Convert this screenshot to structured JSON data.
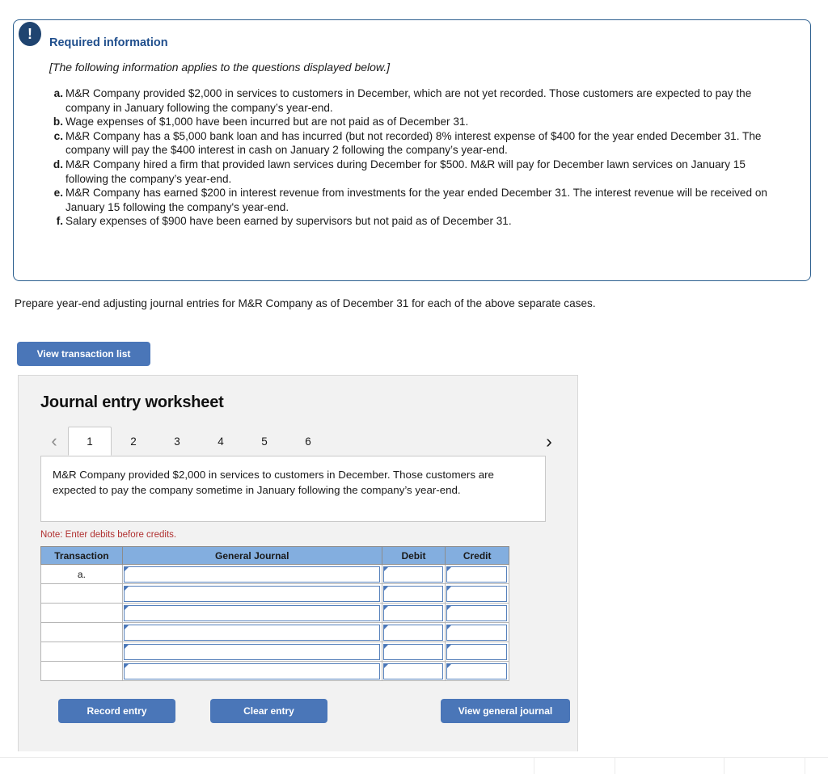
{
  "required_box": {
    "badge_icon": "exclamation-icon",
    "badge_glyph": "!",
    "title": "Required information",
    "subtitle": "[The following information applies to the questions displayed below.]",
    "items": [
      {
        "marker": "a.",
        "text": "M&R Company provided $2,000 in services to customers in December, which are not yet recorded. Those customers are expected to pay the company in January following the company’s year-end."
      },
      {
        "marker": "b.",
        "text": "Wage expenses of $1,000 have been incurred but are not paid as of December 31."
      },
      {
        "marker": "c.",
        "text": "M&R Company has a $5,000 bank loan and has incurred (but not recorded) 8% interest expense of $400 for the year ended December 31. The company will pay the $400 interest in cash on January 2 following the company’s year-end."
      },
      {
        "marker": "d.",
        "text": "M&R Company hired a firm that provided lawn services during December for $500. M&R will pay for December lawn services on January 15 following the company’s year-end."
      },
      {
        "marker": "e.",
        "text": "M&R Company has earned $200 in interest revenue from investments for the year ended December 31. The interest revenue will be received on January 15 following the company's year-end."
      },
      {
        "marker": "f.",
        "text": "Salary expenses of $900 have been earned by supervisors but not paid as of December 31."
      }
    ]
  },
  "instruction": "Prepare year-end adjusting journal entries for M&R Company as of December 31 for each of the above separate cases.",
  "view_transaction_list_button": "View transaction list",
  "worksheet": {
    "title": "Journal entry worksheet",
    "prev_arrow_icon": "chevron-left-icon",
    "prev_arrow_glyph": "‹",
    "next_arrow_icon": "chevron-right-icon",
    "next_arrow_glyph": "›",
    "tabs": [
      {
        "label": "1",
        "active": true
      },
      {
        "label": "2",
        "active": false
      },
      {
        "label": "3",
        "active": false
      },
      {
        "label": "4",
        "active": false
      },
      {
        "label": "5",
        "active": false
      },
      {
        "label": "6",
        "active": false
      }
    ],
    "active_tab_description": "M&R Company provided $2,000 in services to customers in December. Those customers are expected to pay the company sometime in January following the company’s year-end.",
    "note": "Note: Enter debits before credits.",
    "table": {
      "headers": [
        "Transaction",
        "General Journal",
        "Debit",
        "Credit"
      ],
      "rows": [
        {
          "transaction": "a.",
          "general_journal": "",
          "debit": "",
          "credit": ""
        },
        {
          "transaction": "",
          "general_journal": "",
          "debit": "",
          "credit": ""
        },
        {
          "transaction": "",
          "general_journal": "",
          "debit": "",
          "credit": ""
        },
        {
          "transaction": "",
          "general_journal": "",
          "debit": "",
          "credit": ""
        },
        {
          "transaction": "",
          "general_journal": "",
          "debit": "",
          "credit": ""
        },
        {
          "transaction": "",
          "general_journal": "",
          "debit": "",
          "credit": ""
        }
      ]
    },
    "buttons": {
      "record": "Record entry",
      "clear": "Clear entry",
      "view_general_journal": "View general journal"
    }
  },
  "colors": {
    "accent_blue": "#4a76b8",
    "table_header_blue": "#83aedf",
    "heading_navy": "#1f4e8c",
    "badge_navy": "#1f4470",
    "note_red": "#b03030",
    "panel_gray": "#f2f2f2",
    "box_border": "#2c5f8f"
  }
}
